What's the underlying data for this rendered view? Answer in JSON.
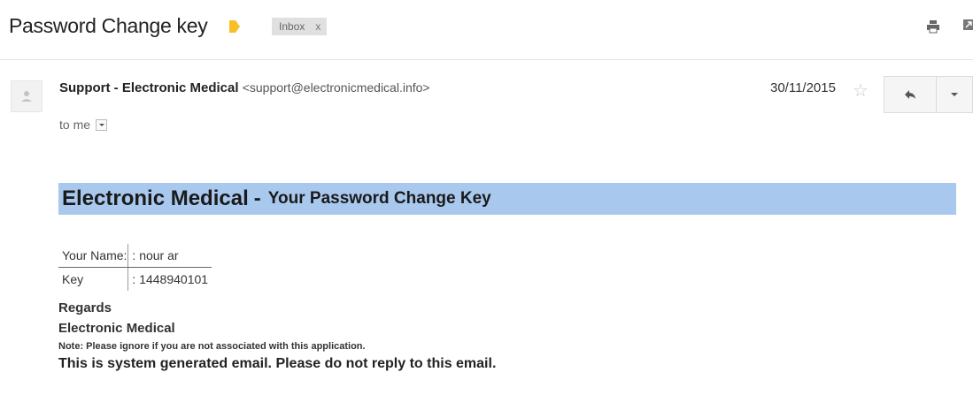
{
  "subject": "Password Change key",
  "label_color": "#f6c026",
  "inbox_chip": {
    "label": "Inbox",
    "close": "x"
  },
  "icons": {
    "print": "print-icon",
    "new_window": "new-window-icon",
    "star": "star-icon",
    "reply": "reply-icon",
    "more": "chevron-down-icon",
    "avatar": "person-icon"
  },
  "message": {
    "sender_name": "Support - Electronic Medical",
    "sender_email": "<support@electronicmedical.info>",
    "to": "to me",
    "date": "30/11/2015"
  },
  "body": {
    "banner_brand": "Electronic Medical",
    "banner_sep": "-",
    "banner_sub": "Your Password Change Key",
    "banner_color": "#a9c8ee",
    "rows": [
      {
        "key": "Your Name:",
        "value": ": nour ar"
      },
      {
        "key": "Key",
        "value": ": 1448940101"
      }
    ],
    "regards": "Regards",
    "org": "Electronic Medical",
    "note": "Note: Please ignore if you are not associated with this application.",
    "footer": "This is system generated email. Please do not reply to this email."
  }
}
